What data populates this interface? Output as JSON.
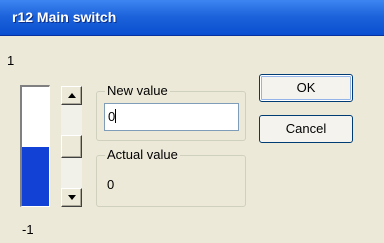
{
  "window": {
    "title": "r12 Main switch"
  },
  "range": {
    "max_label": "1",
    "min_label": "-1"
  },
  "meter": {
    "fill_fraction": 0.5,
    "fill_color": "#1241d6"
  },
  "scrollbar": {
    "up_icon": "arrow-up-icon",
    "down_icon": "arrow-down-icon",
    "position_fraction": 0.5
  },
  "new_value": {
    "legend": "New value",
    "value": "0"
  },
  "actual_value": {
    "legend": "Actual value",
    "value": "0"
  },
  "buttons": {
    "ok": "OK",
    "cancel": "Cancel"
  }
}
